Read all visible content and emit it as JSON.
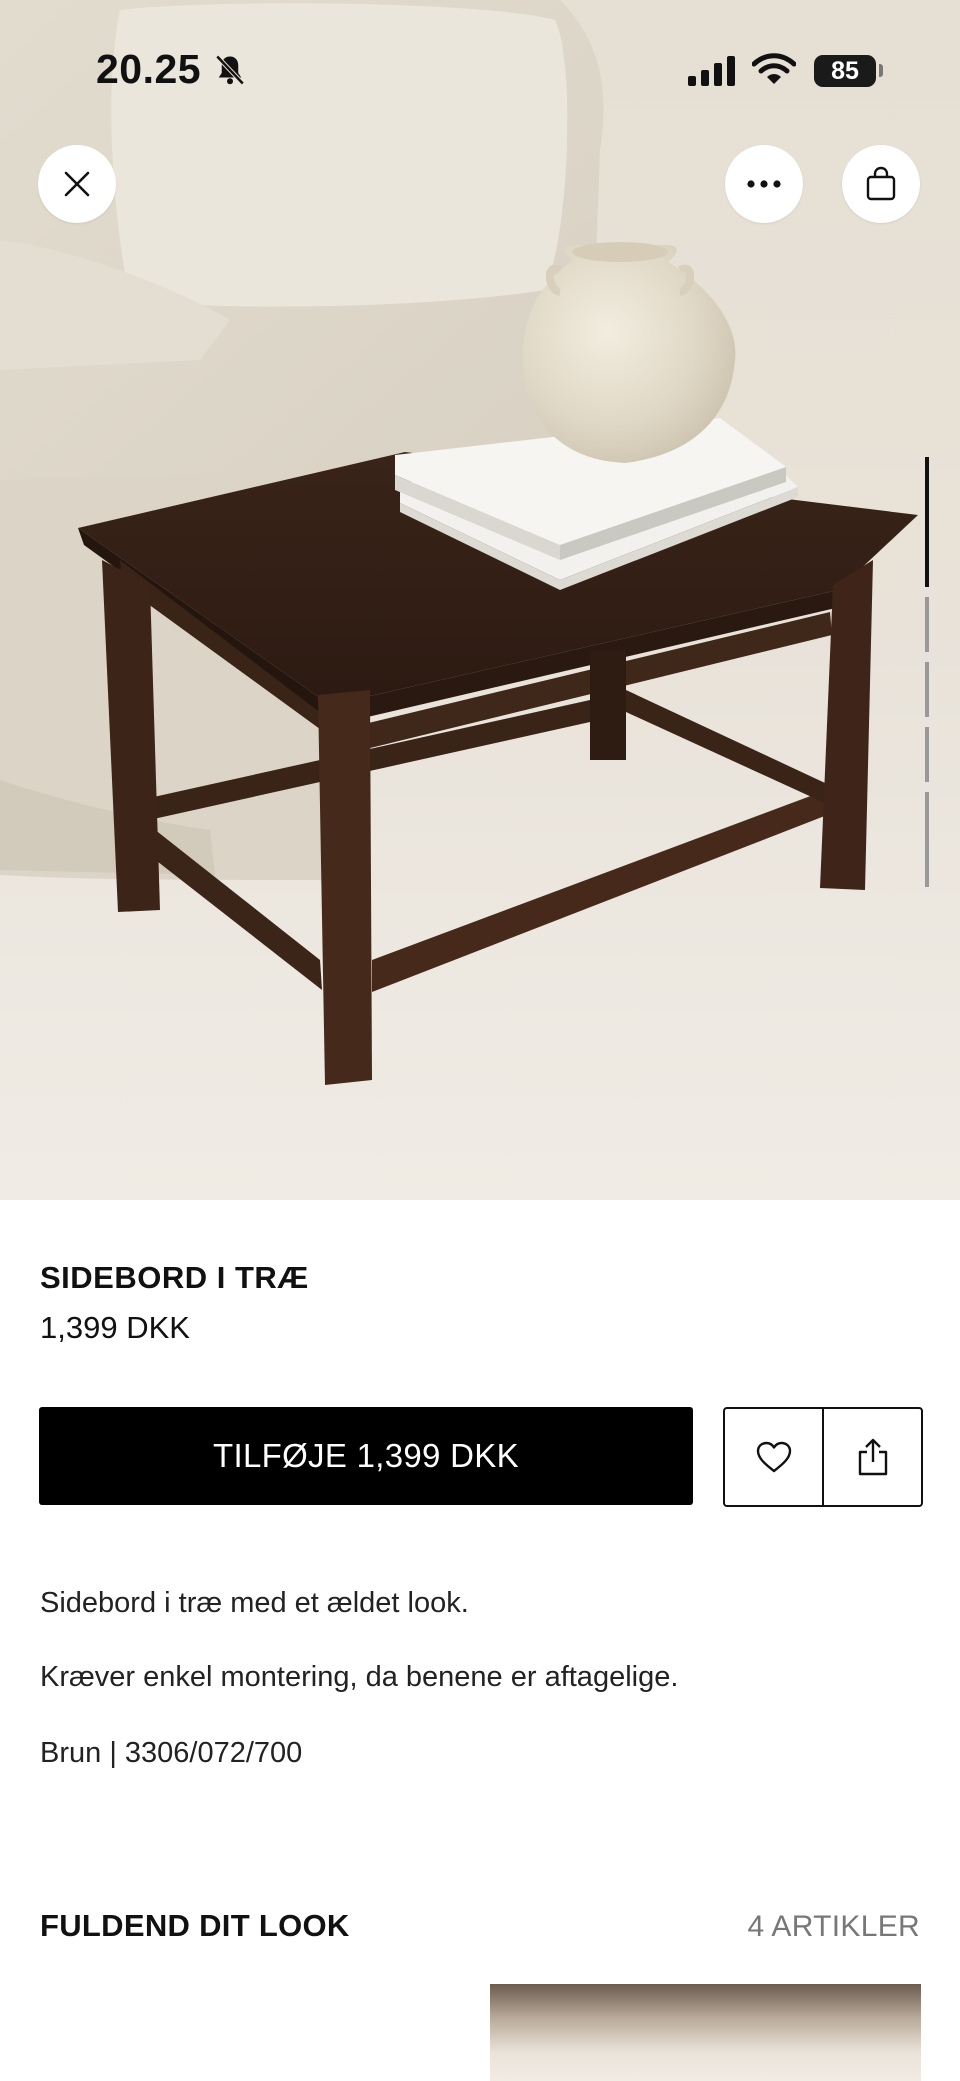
{
  "status_bar": {
    "time": "20.25",
    "battery": "85"
  },
  "icons": {
    "close": "close-icon",
    "more": "more-icon",
    "bag": "bag-icon",
    "wishlist": "heart-icon",
    "share": "share-icon",
    "bell": "bell-muted-icon",
    "signal": "signal-icon",
    "wifi": "wifi-icon"
  },
  "gallery": {
    "image_count": 5,
    "active_index": 0
  },
  "product": {
    "title": "SIDEBORD I TRÆ",
    "price": "1,399 DKK",
    "add_label": "TILFØJE 1,399 DKK",
    "description": [
      "Sidebord i træ med et ældet look.",
      "Kræver enkel montering, da benene er aftagelige.",
      "Brun | 3306/072/700"
    ]
  },
  "complete_look": {
    "title": "FULDEND DIT LOOK",
    "count": "4 ARTIKLER"
  },
  "colors": {
    "button_bg": "#000000",
    "button_text": "#ffffff",
    "table_wood": "#3b2418",
    "backdrop": "#e9e3d8"
  }
}
